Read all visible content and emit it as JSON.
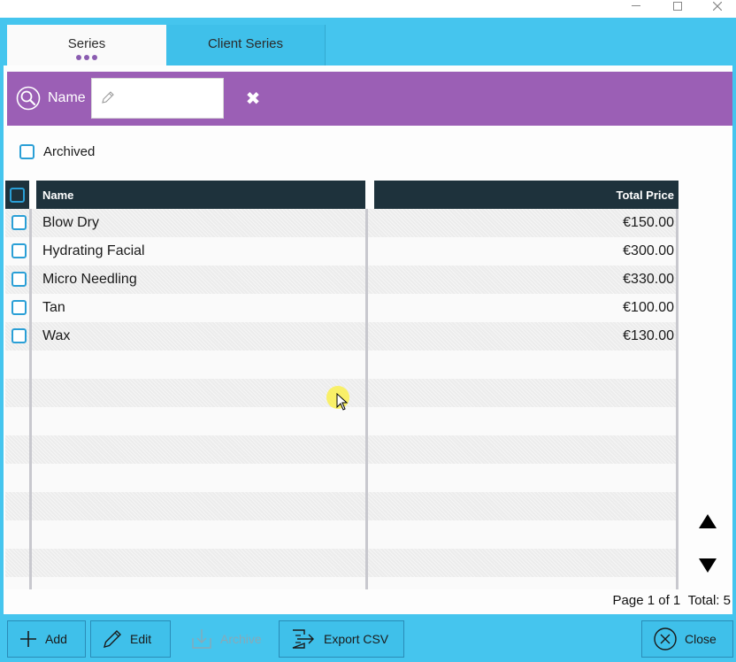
{
  "window": {
    "controls": [
      "minimize",
      "maximize",
      "close"
    ]
  },
  "tabs": [
    {
      "label": "Series",
      "active": true
    },
    {
      "label": "Client Series",
      "active": false
    }
  ],
  "search": {
    "label": "Name",
    "value": "",
    "placeholder": ""
  },
  "filters": {
    "archived_label": "Archived",
    "archived_checked": false
  },
  "table": {
    "columns": [
      "Name",
      "Total Price"
    ],
    "rows": [
      {
        "name": "Blow Dry",
        "price": "€150.00"
      },
      {
        "name": "Hydrating Facial",
        "price": "€300.00"
      },
      {
        "name": "Micro Needling",
        "price": "€330.00"
      },
      {
        "name": "Tan",
        "price": "€100.00"
      },
      {
        "name": "Wax",
        "price": "€130.00"
      }
    ]
  },
  "pagination": {
    "page_text": "Page 1 of 1",
    "total_text": "Total: 5"
  },
  "toolbar": {
    "add_label": "Add",
    "edit_label": "Edit",
    "archive_label": "Archive",
    "export_label": "Export CSV",
    "close_label": "Close"
  },
  "colors": {
    "frame": "#45c5ee",
    "search_bar": "#9b5fb5",
    "header": "#1e323c",
    "checkbox": "#2a9fd6"
  }
}
